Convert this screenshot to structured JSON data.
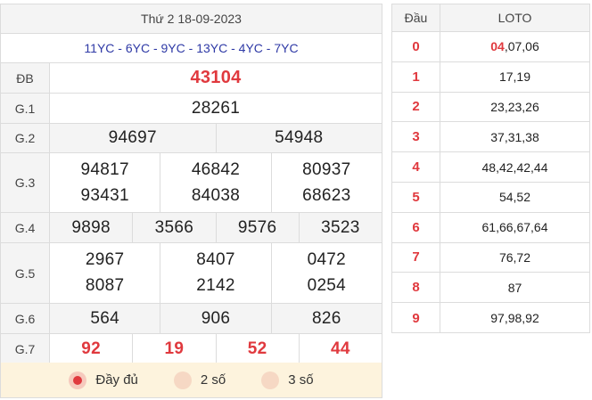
{
  "header": {
    "date": "Thứ 2 18-09-2023"
  },
  "codes": "11YC - 6YC - 9YC - 13YC - 4YC - 7YC",
  "prizes": {
    "db": {
      "label": "ĐB",
      "numbers": [
        "43104"
      ]
    },
    "g1": {
      "label": "G.1",
      "numbers": [
        "28261"
      ]
    },
    "g2": {
      "label": "G.2",
      "numbers": [
        "94697",
        "54948"
      ]
    },
    "g3": {
      "label": "G.3",
      "numbers": [
        "94817",
        "46842",
        "80937",
        "93431",
        "84038",
        "68623"
      ]
    },
    "g4": {
      "label": "G.4",
      "numbers": [
        "9898",
        "3566",
        "9576",
        "3523"
      ]
    },
    "g5": {
      "label": "G.5",
      "numbers": [
        "2967",
        "8407",
        "0472",
        "8087",
        "2142",
        "0254"
      ]
    },
    "g6": {
      "label": "G.6",
      "numbers": [
        "564",
        "906",
        "826"
      ]
    },
    "g7": {
      "label": "G.7",
      "numbers": [
        "92",
        "19",
        "52",
        "44"
      ]
    }
  },
  "options": [
    {
      "label": "Đầy đủ",
      "selected": true
    },
    {
      "label": "2 số",
      "selected": false
    },
    {
      "label": "3 số",
      "selected": false
    }
  ],
  "loto": {
    "head_dau": "Đầu",
    "head_loto": "LOTO",
    "rows": [
      {
        "dau": "0",
        "highlight": "04",
        "rest": ",07,06"
      },
      {
        "dau": "1",
        "highlight": "",
        "rest": "17,19"
      },
      {
        "dau": "2",
        "highlight": "",
        "rest": "23,23,26"
      },
      {
        "dau": "3",
        "highlight": "",
        "rest": "37,31,38"
      },
      {
        "dau": "4",
        "highlight": "",
        "rest": "48,42,42,44"
      },
      {
        "dau": "5",
        "highlight": "",
        "rest": "54,52"
      },
      {
        "dau": "6",
        "highlight": "",
        "rest": "61,66,67,64"
      },
      {
        "dau": "7",
        "highlight": "",
        "rest": "76,72"
      },
      {
        "dau": "8",
        "highlight": "",
        "rest": "87"
      },
      {
        "dau": "9",
        "highlight": "",
        "rest": "97,98,92"
      }
    ]
  },
  "colors": {
    "accent": "#e0393e",
    "codes": "#2f3aa6",
    "footer_bg": "#fdf3dd"
  }
}
